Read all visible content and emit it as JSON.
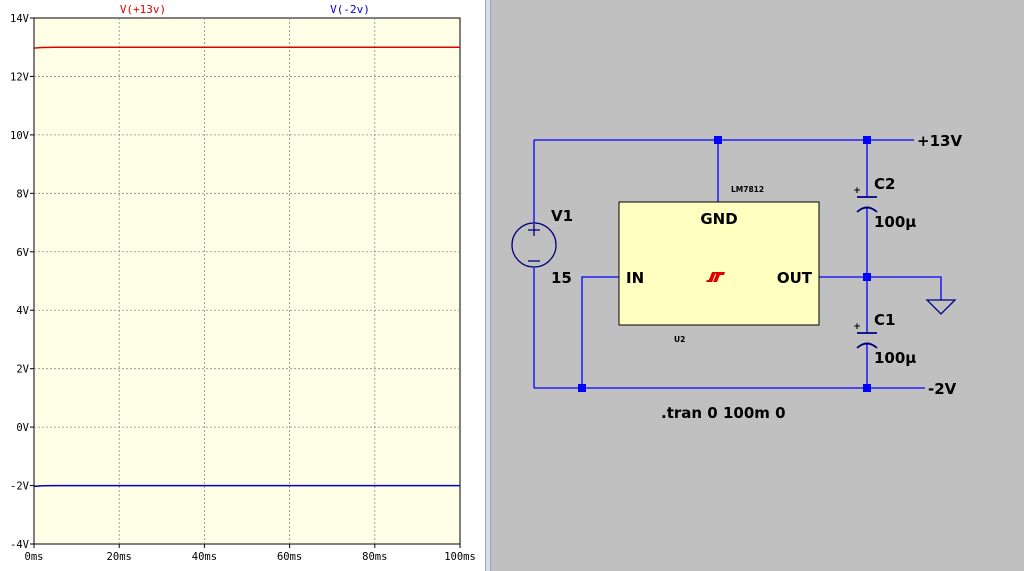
{
  "waveform": {
    "traces": [
      {
        "name": "V(+13v)",
        "color": "#e00000"
      },
      {
        "name": "V(-2v)",
        "color": "#0000cc"
      }
    ]
  },
  "chart_data": {
    "type": "line",
    "title": "",
    "xlabel": "",
    "ylabel": "",
    "x_ticks": [
      "0ms",
      "20ms",
      "40ms",
      "60ms",
      "80ms",
      "100ms"
    ],
    "y_ticks": [
      "-4V",
      "-2V",
      "0V",
      "2V",
      "4V",
      "6V",
      "8V",
      "10V",
      "12V",
      "14V"
    ],
    "xlim": [
      0,
      100
    ],
    "ylim": [
      -4,
      14
    ],
    "grid": true,
    "background": "#ffffe8",
    "series": [
      {
        "name": "V(+13v)",
        "color": "#e00000",
        "x": [
          0,
          1,
          2,
          5,
          10,
          20,
          40,
          60,
          80,
          100
        ],
        "y": [
          12.97,
          12.98,
          12.99,
          13.0,
          13.0,
          13.0,
          13.0,
          13.0,
          13.0,
          13.0
        ]
      },
      {
        "name": "V(-2v)",
        "color": "#0000cc",
        "x": [
          0,
          1,
          2,
          5,
          10,
          20,
          40,
          60,
          80,
          100
        ],
        "y": [
          -2.03,
          -2.02,
          -2.01,
          -2.0,
          -2.0,
          -2.0,
          -2.0,
          -2.0,
          -2.0,
          -2.0
        ]
      }
    ]
  },
  "schematic": {
    "source_name": "V1",
    "source_value": "15",
    "regulator_part": "LM7812",
    "regulator_ref": "U2",
    "pin_gnd": "GND",
    "pin_in": "IN",
    "pin_out": "OUT",
    "c2_name": "C2",
    "c2_value": "100µ",
    "c1_name": "C1",
    "c1_value": "100µ",
    "net_pos": "+13V",
    "net_neg": "-2V",
    "directive": ".tran 0 100m 0",
    "wire_color": "#0000ff",
    "component_color": "#000080",
    "regulator_fill": "#ffffc0",
    "logo_color": "#e00000"
  }
}
